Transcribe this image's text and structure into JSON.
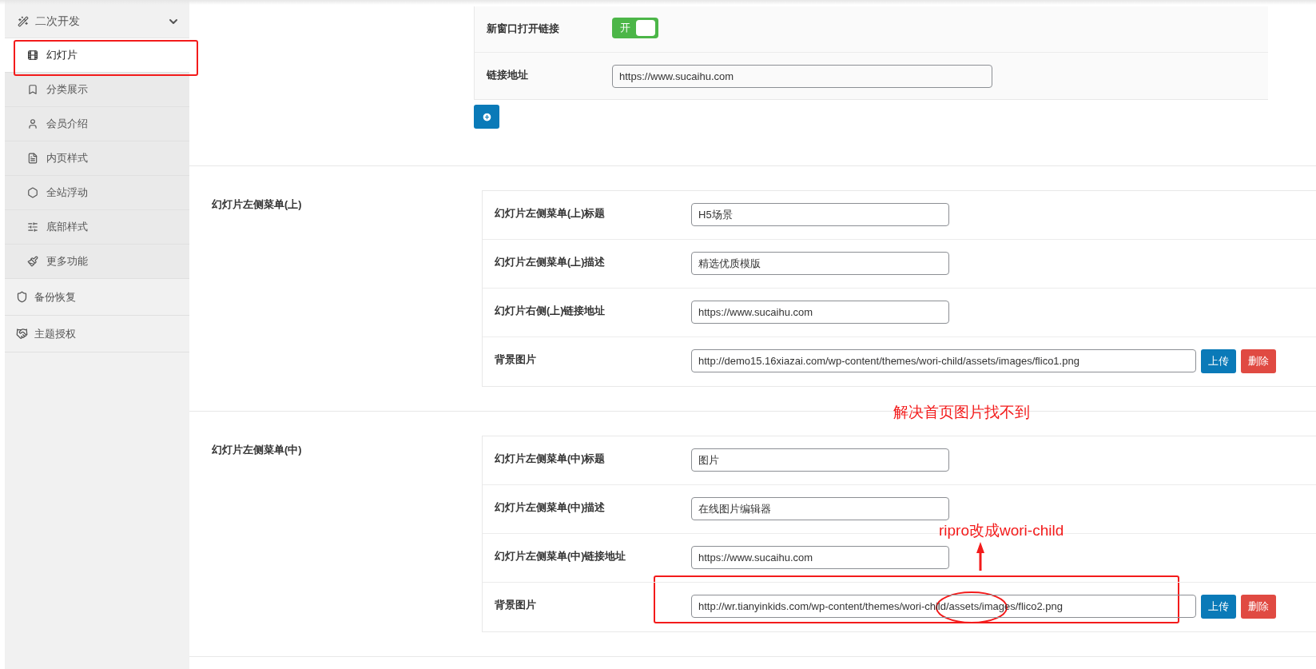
{
  "sidebar": {
    "groups": [
      {
        "label": "二次开发",
        "expanded": true,
        "children": [
          {
            "label": "幻灯片",
            "selected": true
          },
          {
            "label": "分类展示",
            "selected": false
          },
          {
            "label": "会员介绍",
            "selected": false
          },
          {
            "label": "内页样式",
            "selected": false
          },
          {
            "label": "全站浮动",
            "selected": false
          },
          {
            "label": "底部样式",
            "selected": false
          },
          {
            "label": "更多功能",
            "selected": false
          }
        ]
      }
    ],
    "items": [
      {
        "label": "备份恢复"
      },
      {
        "label": "主题授权"
      }
    ]
  },
  "top_section": {
    "rows": [
      {
        "kind": "switch",
        "label": "新窗口打开链接",
        "on": true,
        "switch_text": "开"
      },
      {
        "kind": "text",
        "label": "链接地址",
        "value": "https://www.sucaihu.com"
      }
    ]
  },
  "sections": [
    {
      "title": "幻灯片左侧菜单(上)",
      "fields": [
        {
          "kind": "text",
          "label": "幻灯片左侧菜单(上)标题",
          "value": "H5场景"
        },
        {
          "kind": "text",
          "label": "幻灯片左侧菜单(上)描述",
          "value": "精选优质模版"
        },
        {
          "kind": "text",
          "label": "幻灯片右侧(上)链接地址",
          "value": "https://www.sucaihu.com"
        },
        {
          "kind": "image",
          "label": "背景图片",
          "value": "http://demo15.16xiazai.com/wp-content/themes/wori-child/assets/images/flico1.png",
          "buttons": [
            "上传",
            "删除"
          ]
        }
      ]
    },
    {
      "title": "幻灯片左侧菜单(中)",
      "fields": [
        {
          "kind": "text",
          "label": "幻灯片左侧菜单(中)标题",
          "value": "图片"
        },
        {
          "kind": "text",
          "label": "幻灯片左侧菜单(中)描述",
          "value": "在线图片编辑器"
        },
        {
          "kind": "text",
          "label": "幻灯片左侧菜单(中)链接地址",
          "value": "https://www.sucaihu.com"
        },
        {
          "kind": "image",
          "label": "背景图片",
          "value": "http://wr.tianyinkids.com/wp-content/themes/wori-child/assets/images/flico2.png",
          "buttons": [
            "上传",
            "删除"
          ]
        }
      ]
    }
  ],
  "annotations": [
    {
      "text": "解决首页图片找不到"
    },
    {
      "text": "ripro改成wori-child"
    }
  ]
}
